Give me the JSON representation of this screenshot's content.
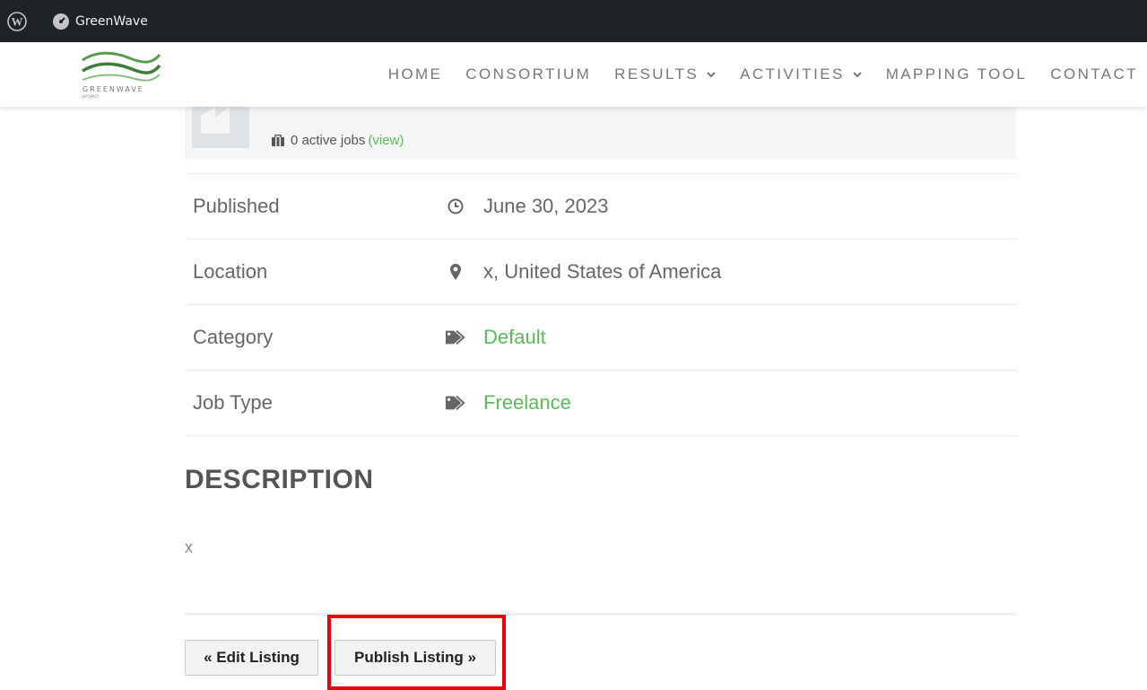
{
  "adminbar": {
    "site_name": "GreenWave"
  },
  "header": {
    "logo_text": "GREENWAVE",
    "logo_sub": "project",
    "nav": [
      {
        "label": "HOME",
        "dropdown": false
      },
      {
        "label": "CONSORTIUM",
        "dropdown": false
      },
      {
        "label": "RESULTS",
        "dropdown": true
      },
      {
        "label": "ACTIVITIES",
        "dropdown": true
      },
      {
        "label": "MAPPING TOOL",
        "dropdown": false
      },
      {
        "label": "CONTACT",
        "dropdown": false
      }
    ]
  },
  "company": {
    "active_jobs": "0 active jobs",
    "view_link": "(view)"
  },
  "meta": {
    "published_label": "Published",
    "published_value": "June 30, 2023",
    "location_label": "Location",
    "location_value": "x, United States of America",
    "category_label": "Category",
    "category_value": "Default",
    "jobtype_label": "Job Type",
    "jobtype_value": "Freelance"
  },
  "description": {
    "title": "DESCRIPTION",
    "text": "x"
  },
  "actions": {
    "edit_label": "« Edit Listing",
    "publish_label": "Publish Listing »"
  },
  "colors": {
    "accent_green": "#5cb85c",
    "highlight_red": "#e8000b",
    "adminbar_bg": "#1d2327"
  }
}
